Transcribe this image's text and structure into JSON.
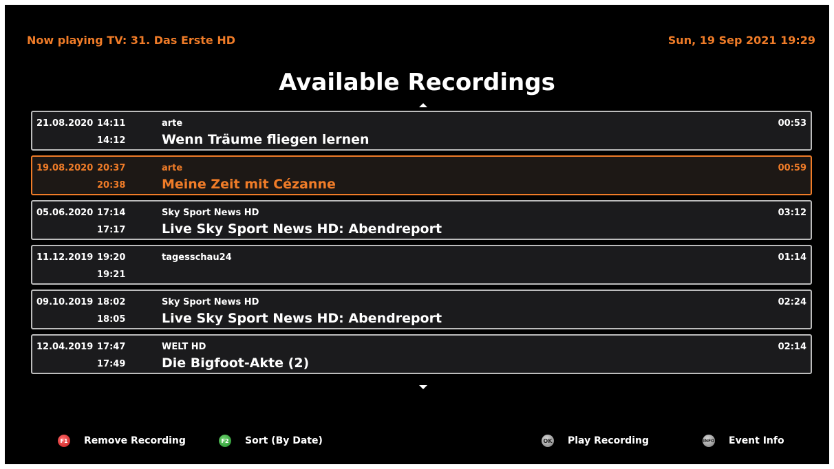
{
  "header": {
    "now_playing": "Now playing TV: 31. Das Erste HD",
    "datetime": "Sun, 19 Sep 2021 19:29"
  },
  "title": "Available Recordings",
  "recordings": [
    {
      "date": "21.08.2020",
      "start": "14:11",
      "end": "14:12",
      "channel": "arte",
      "event": "Wenn Träume fliegen lernen",
      "duration": "00:53",
      "selected": false
    },
    {
      "date": "19.08.2020",
      "start": "20:37",
      "end": "20:38",
      "channel": "arte",
      "event": "Meine Zeit mit Cézanne",
      "duration": "00:59",
      "selected": true
    },
    {
      "date": "05.06.2020",
      "start": "17:14",
      "end": "17:17",
      "channel": "Sky Sport News HD",
      "event": "Live Sky Sport News HD: Abendreport",
      "duration": "03:12",
      "selected": false
    },
    {
      "date": "11.12.2019",
      "start": "19:20",
      "end": "19:21",
      "channel": "tagesschau24",
      "event": "",
      "duration": "01:14",
      "selected": false
    },
    {
      "date": "09.10.2019",
      "start": "18:02",
      "end": "18:05",
      "channel": "Sky Sport News HD",
      "event": "Live Sky Sport News HD: Abendreport",
      "duration": "02:24",
      "selected": false
    },
    {
      "date": "12.04.2019",
      "start": "17:47",
      "end": "17:49",
      "channel": "WELT HD",
      "event": "Die Bigfoot-Akte (2)",
      "duration": "02:14",
      "selected": false
    }
  ],
  "footer": {
    "f1": {
      "key": "F1",
      "label": "Remove Recording",
      "icon": "red-f1-key-icon"
    },
    "f2": {
      "key": "F2",
      "label": "Sort (By Date)",
      "icon": "green-f2-key-icon"
    },
    "ok": {
      "key": "OK",
      "label": "Play Recording",
      "icon": "ok-key-icon"
    },
    "info": {
      "key": "INFO",
      "label": "Event Info",
      "icon": "info-key-icon"
    }
  },
  "colors": {
    "accent": "#f07c28",
    "background": "#000000",
    "row_bg": "#1b1b1d",
    "row_border": "#bdbdbd"
  }
}
